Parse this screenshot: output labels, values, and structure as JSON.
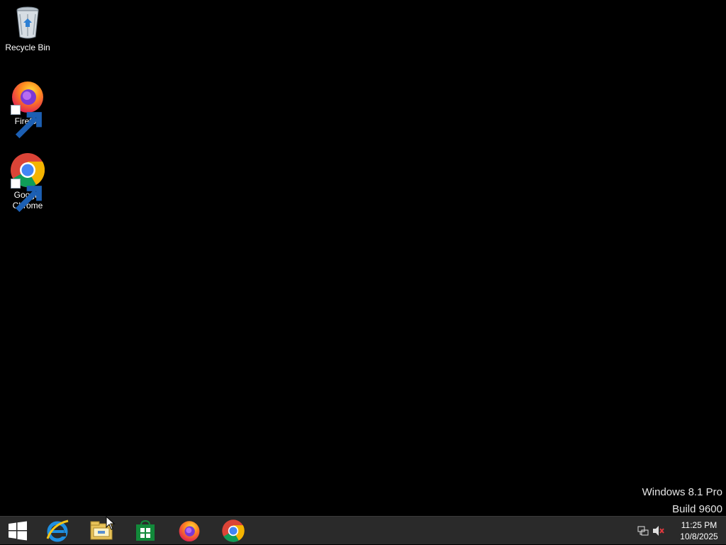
{
  "desktop": {
    "icons": [
      {
        "label": "Recycle Bin",
        "icon": "recycle-bin-icon"
      },
      {
        "label": "Firefox",
        "icon": "firefox-icon"
      },
      {
        "label": "Google Chrome",
        "icon": "chrome-icon"
      }
    ],
    "watermark": {
      "line1": "Windows 8.1 Pro",
      "line2": "Build 9600"
    }
  },
  "taskbar": {
    "pinned": [
      {
        "name": "start",
        "icon": "windows-logo-icon"
      },
      {
        "name": "internet-explorer",
        "icon": "internet-explorer-icon"
      },
      {
        "name": "file-explorer",
        "icon": "file-explorer-icon"
      },
      {
        "name": "store",
        "icon": "store-icon"
      },
      {
        "name": "firefox",
        "icon": "firefox-icon"
      },
      {
        "name": "chrome",
        "icon": "chrome-icon"
      }
    ],
    "tray": {
      "network_icon": "network-icon",
      "volume_icon": "volume-muted-icon",
      "time": "11:25 PM",
      "date": "10/8/2025"
    }
  },
  "colors": {
    "taskbar": "#2a2a2a",
    "desktop": "#000000"
  }
}
